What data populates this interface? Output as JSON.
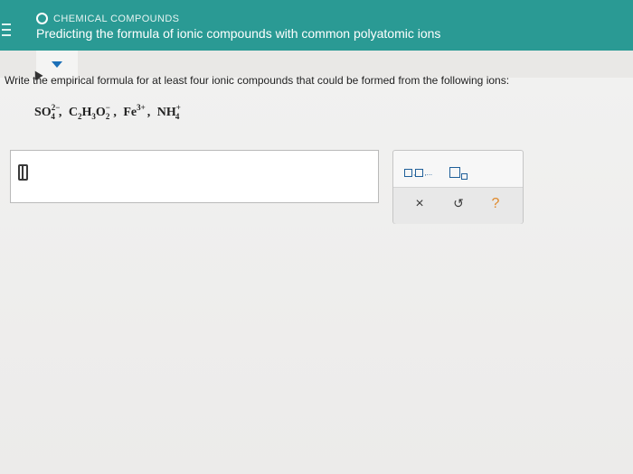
{
  "header": {
    "topic": "CHEMICAL COMPOUNDS",
    "title": "Predicting the formula of ionic compounds with common polyatomic ions",
    "menu_icon": "hamburger-menu-icon",
    "topic_icon": "circle-icon"
  },
  "question": {
    "prompt": "Write the empirical formula for at least four ionic compounds that could be formed from the following ions:",
    "ions": [
      {
        "base": "SO",
        "sub": "4",
        "sup": "2−"
      },
      {
        "base": "C",
        "sub": "2",
        "base2": "H",
        "sub2": "3",
        "base3": "O",
        "sub3": "2",
        "sup": "−"
      },
      {
        "base": "Fe",
        "sup": "3+"
      },
      {
        "base": "NH",
        "sub": "4",
        "sup": "+"
      }
    ],
    "separator": ",",
    "dots": "..."
  },
  "tools": {
    "list_label": "□,□,...",
    "subscript_label": "□□",
    "clear_icon": "×",
    "undo_icon": "↺",
    "help_icon": "?"
  },
  "colors": {
    "header_bg": "#2a9a94",
    "accent_blue": "#1f5f99",
    "help_orange": "#e0892a"
  }
}
